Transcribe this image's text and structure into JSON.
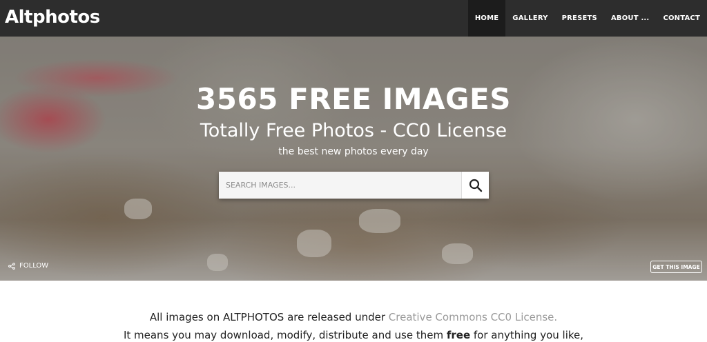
{
  "brand": "Altphotos",
  "nav": [
    {
      "label": "HOME",
      "active": true
    },
    {
      "label": "GALLERY",
      "active": false
    },
    {
      "label": "PRESETS",
      "active": false
    },
    {
      "label": "ABOUT ...",
      "active": false
    },
    {
      "label": "CONTACT",
      "active": false
    }
  ],
  "hero": {
    "title": "3565 FREE IMAGES",
    "subtitle": "Totally Free Photos - CC0 License",
    "tagline": "the best new photos every day"
  },
  "search": {
    "placeholder": "SEARCH IMAGES...",
    "icon": "search-icon"
  },
  "follow": {
    "label": "FOLLOW",
    "icon": "share-icon"
  },
  "get_image": {
    "label": "GET THIS IMAGE"
  },
  "content": {
    "line1_prefix": "All images on ALTPHOTOS are released under ",
    "line1_link": "Creative Commons CC0 License.",
    "line2_prefix": "It means you may download, modify, distribute and use them ",
    "line2_bold": "free",
    "line2_suffix": " for anything you like,"
  },
  "colors": {
    "navbar": "#2d2d2d",
    "nav_active": "#1c1c1c",
    "link_muted": "#9a9a9a"
  }
}
